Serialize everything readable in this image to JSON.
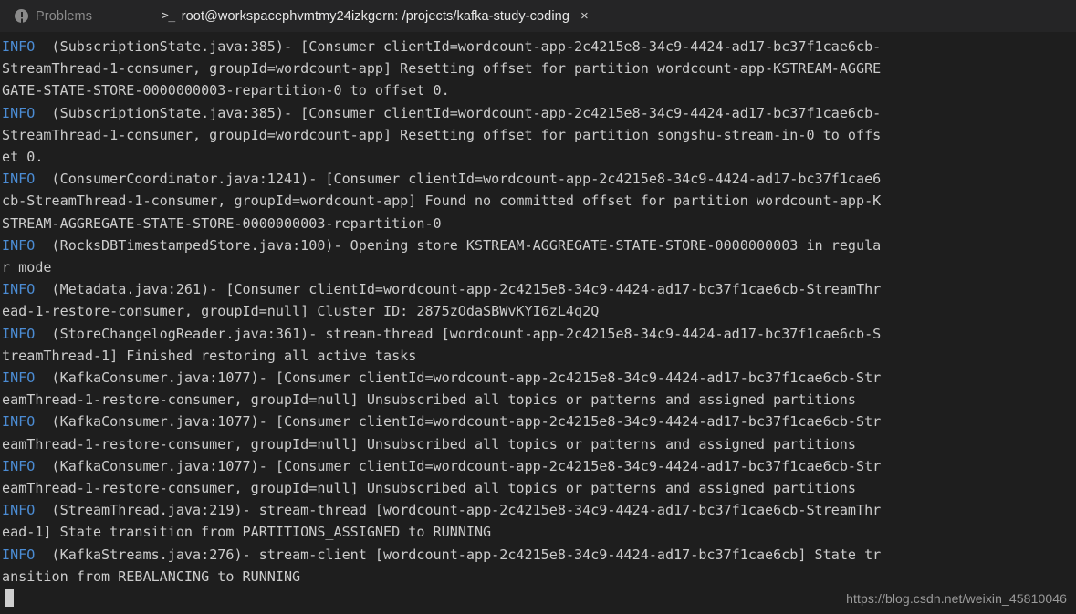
{
  "panel": {
    "tabs": [
      {
        "label": "Problems",
        "icon": "error-circle-icon",
        "active": false
      },
      {
        "label": "root@workspacephvmtmy24izkgern: /projects/kafka-study-coding",
        "icon": "terminal-prompt-icon",
        "active": true
      }
    ],
    "close_label": "×",
    "prompt_glyph": ">_"
  },
  "colors": {
    "background": "#1e1e1e",
    "tabbar_background": "#252526",
    "foreground": "#cccccc",
    "info_level": "#4b8cd4",
    "inactive_tab_text": "#8a8a8a",
    "active_tab_text": "#e7e7e7",
    "cursor": "#cfcfcf",
    "watermark_text": "#9b9b9b"
  },
  "terminal": {
    "cursor_visible": true,
    "log_lines": [
      {
        "level": "INFO",
        "text": "  (SubscriptionState.java:385)- [Consumer clientId=wordcount-app-2c4215e8-34c9-4424-ad17-bc37f1cae6cb-"
      },
      {
        "level": "",
        "text": "StreamThread-1-consumer, groupId=wordcount-app] Resetting offset for partition wordcount-app-KSTREAM-AGGRE"
      },
      {
        "level": "",
        "text": "GATE-STATE-STORE-0000000003-repartition-0 to offset 0."
      },
      {
        "level": "INFO",
        "text": "  (SubscriptionState.java:385)- [Consumer clientId=wordcount-app-2c4215e8-34c9-4424-ad17-bc37f1cae6cb-"
      },
      {
        "level": "",
        "text": "StreamThread-1-consumer, groupId=wordcount-app] Resetting offset for partition songshu-stream-in-0 to offs"
      },
      {
        "level": "",
        "text": "et 0."
      },
      {
        "level": "INFO",
        "text": "  (ConsumerCoordinator.java:1241)- [Consumer clientId=wordcount-app-2c4215e8-34c9-4424-ad17-bc37f1cae6"
      },
      {
        "level": "",
        "text": "cb-StreamThread-1-consumer, groupId=wordcount-app] Found no committed offset for partition wordcount-app-K"
      },
      {
        "level": "",
        "text": "STREAM-AGGREGATE-STATE-STORE-0000000003-repartition-0"
      },
      {
        "level": "INFO",
        "text": "  (RocksDBTimestampedStore.java:100)- Opening store KSTREAM-AGGREGATE-STATE-STORE-0000000003 in regula"
      },
      {
        "level": "",
        "text": "r mode"
      },
      {
        "level": "INFO",
        "text": "  (Metadata.java:261)- [Consumer clientId=wordcount-app-2c4215e8-34c9-4424-ad17-bc37f1cae6cb-StreamThr"
      },
      {
        "level": "",
        "text": "ead-1-restore-consumer, groupId=null] Cluster ID: 2875zOdaSBWvKYI6zL4q2Q"
      },
      {
        "level": "INFO",
        "text": "  (StoreChangelogReader.java:361)- stream-thread [wordcount-app-2c4215e8-34c9-4424-ad17-bc37f1cae6cb-S"
      },
      {
        "level": "",
        "text": "treamThread-1] Finished restoring all active tasks"
      },
      {
        "level": "INFO",
        "text": "  (KafkaConsumer.java:1077)- [Consumer clientId=wordcount-app-2c4215e8-34c9-4424-ad17-bc37f1cae6cb-Str"
      },
      {
        "level": "",
        "text": "eamThread-1-restore-consumer, groupId=null] Unsubscribed all topics or patterns and assigned partitions"
      },
      {
        "level": "INFO",
        "text": "  (KafkaConsumer.java:1077)- [Consumer clientId=wordcount-app-2c4215e8-34c9-4424-ad17-bc37f1cae6cb-Str"
      },
      {
        "level": "",
        "text": "eamThread-1-restore-consumer, groupId=null] Unsubscribed all topics or patterns and assigned partitions"
      },
      {
        "level": "INFO",
        "text": "  (KafkaConsumer.java:1077)- [Consumer clientId=wordcount-app-2c4215e8-34c9-4424-ad17-bc37f1cae6cb-Str"
      },
      {
        "level": "",
        "text": "eamThread-1-restore-consumer, groupId=null] Unsubscribed all topics or patterns and assigned partitions"
      },
      {
        "level": "INFO",
        "text": "  (StreamThread.java:219)- stream-thread [wordcount-app-2c4215e8-34c9-4424-ad17-bc37f1cae6cb-StreamThr"
      },
      {
        "level": "",
        "text": "ead-1] State transition from PARTITIONS_ASSIGNED to RUNNING"
      },
      {
        "level": "INFO",
        "text": "  (KafkaStreams.java:276)- stream-client [wordcount-app-2c4215e8-34c9-4424-ad17-bc37f1cae6cb] State tr"
      },
      {
        "level": "",
        "text": "ansition from REBALANCING to RUNNING"
      }
    ]
  },
  "watermark": "https://blog.csdn.net/weixin_45810046"
}
